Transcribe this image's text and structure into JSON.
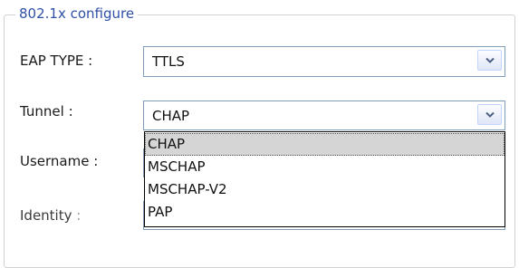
{
  "group": {
    "title": "802.1x configure"
  },
  "eap_type": {
    "label": "EAP TYPE :",
    "value": "TTLS",
    "button_icon": "chevron-down-icon"
  },
  "tunnel": {
    "label": "Tunnel :",
    "value": "CHAP",
    "button_icon": "chevron-down-icon",
    "options": [
      {
        "label": "CHAP",
        "selected": true
      },
      {
        "label": "MSCHAP",
        "selected": false
      },
      {
        "label": "MSCHAP-V2",
        "selected": false
      },
      {
        "label": "PAP",
        "selected": false
      }
    ]
  },
  "username": {
    "label": "Username :",
    "value": ""
  },
  "identity": {
    "label": "Identity",
    "separator": ":",
    "value": ""
  },
  "colors": {
    "legend_text": "#2f4fa6",
    "field_border": "#7f9db9",
    "selected_option_bg": "#d5d5d5"
  }
}
